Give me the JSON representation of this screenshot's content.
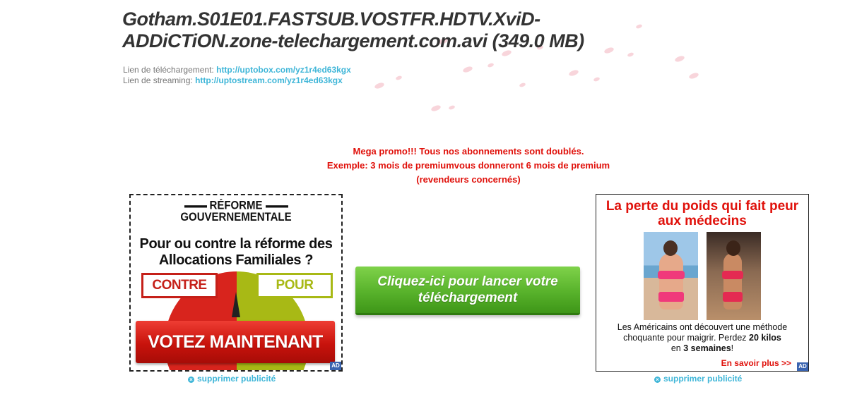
{
  "file": {
    "title": "Gotham.S01E01.FASTSUB.VOSTFR.HDTV.XviD-ADDiCTiON.zone-telechargement.com.avi (349.0 MB)"
  },
  "links": {
    "download_label": "Lien de téléchargement:",
    "download_url": "http://uptobox.com/yz1r4ed63kgx",
    "streaming_label": "Lien de streaming:",
    "streaming_url": "http://uptostream.com/yz1r4ed63kgx"
  },
  "promo": {
    "line1": "Mega promo!!! Tous nos abonnements sont doublés.",
    "line2": "Exemple: 3 mois de premiumvous donneront 6 mois de premium",
    "line3": "(revendeurs concernés)"
  },
  "download_button": {
    "label": "Cliquez-ici pour lancer votre téléchargement"
  },
  "ad_left": {
    "tag_line1": "RÉFORME",
    "tag_line2": "GOUVERNEMENTALE",
    "question": "Pour ou contre la réforme des Allocations Familiales ?",
    "contre": "CONTRE",
    "pour": "POUR",
    "cta": "VOTEZ MAINTENANT",
    "badge": "AD"
  },
  "ad_right": {
    "title": "La perte du poids qui fait peur aux médecins",
    "desc_part1": "Les Américains ont découvert une méthode choquante pour maigrir. Perdez",
    "desc_bold1": "20 kilos",
    "desc_part2": "en",
    "desc_bold2": "3 semaines",
    "desc_part3": "!",
    "more": "En savoir plus >>",
    "badge": "AD"
  },
  "remove_ad_label": "supprimer publicité",
  "colors": {
    "link": "#3fb6d8",
    "promo": "#e0110b",
    "button_green": "#58b22b"
  }
}
